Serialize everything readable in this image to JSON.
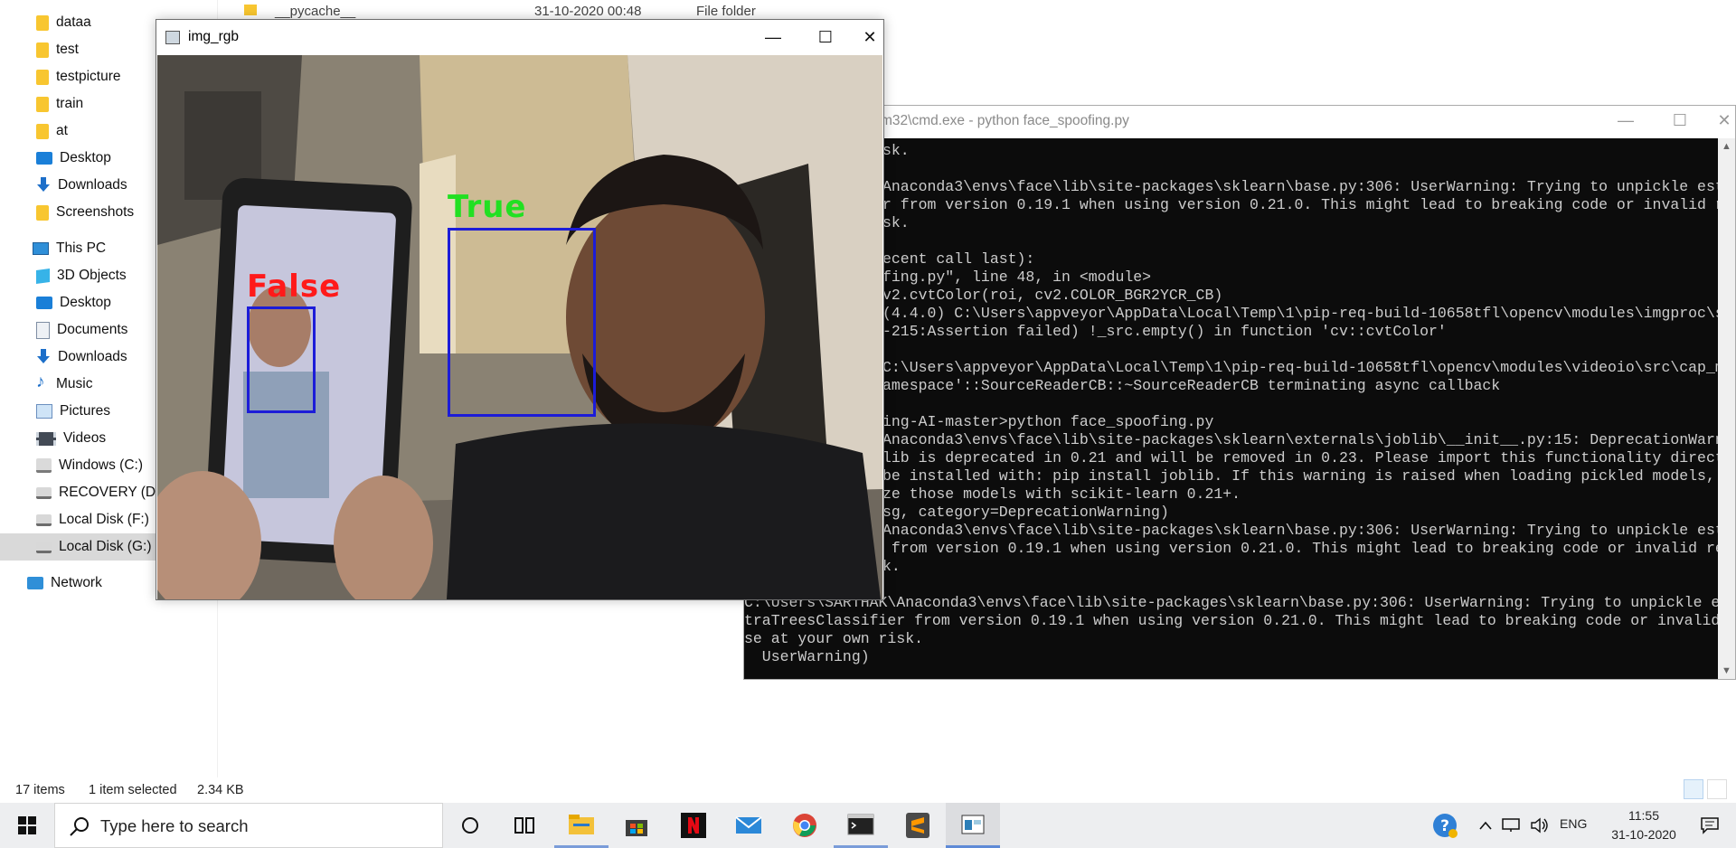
{
  "explorer": {
    "nav_items": [
      {
        "label": "dataa",
        "icon": "folder-icon"
      },
      {
        "label": "test",
        "icon": "folder-icon"
      },
      {
        "label": "testpicture",
        "icon": "folder-icon"
      },
      {
        "label": "train",
        "icon": "folder-icon"
      },
      {
        "label": "at",
        "icon": "folder-icon"
      },
      {
        "label": "Desktop",
        "icon": "desktop-icon"
      },
      {
        "label": "Downloads",
        "icon": "downloads-icon"
      },
      {
        "label": "Screenshots",
        "icon": "folder-icon"
      },
      {
        "label": "This PC",
        "icon": "this-pc-icon"
      },
      {
        "label": "3D Objects",
        "icon": "3d-objects-icon"
      },
      {
        "label": "Desktop",
        "icon": "desktop-icon"
      },
      {
        "label": "Documents",
        "icon": "documents-icon"
      },
      {
        "label": "Downloads",
        "icon": "downloads-icon"
      },
      {
        "label": "Music",
        "icon": "music-icon"
      },
      {
        "label": "Pictures",
        "icon": "pictures-icon"
      },
      {
        "label": "Videos",
        "icon": "videos-icon"
      },
      {
        "label": "Windows (C:)",
        "icon": "windows-drive-icon"
      },
      {
        "label": "RECOVERY (D:)",
        "icon": "disk-drive-icon"
      },
      {
        "label": "Local Disk (F:)",
        "icon": "disk-drive-icon"
      },
      {
        "label": "Local Disk (G:)",
        "icon": "disk-drive-icon"
      },
      {
        "label": "Network",
        "icon": "network-icon"
      }
    ],
    "file_row": {
      "name": "__pycache__",
      "date": "31-10-2020 00:48",
      "type": "File folder"
    },
    "status": {
      "count": "17 items",
      "selection": "1 item selected",
      "size": "2.34 KB"
    }
  },
  "console": {
    "title": "m32\\cmd.exe - python  face_spoofing.py",
    "lines": [
      "sk.",
      "",
      "Anaconda3\\envs\\face\\lib\\site-packages\\sklearn\\base.py:306: UserWarning: Trying to unpickle estimator Ex",
      "r from version 0.19.1 when using version 0.21.0. This might lead to breaking code or invalid results. U",
      "sk.",
      "",
      "ecent call last):",
      "fing.py\", line 48, in <module>",
      "v2.cvtColor(roi, cv2.COLOR_BGR2YCR_CB)",
      "(4.4.0) C:\\Users\\appveyor\\AppData\\Local\\Temp\\1\\pip-req-build-10658tfl\\opencv\\modules\\imgproc\\src\\color.",
      "-215:Assertion failed) !_src.empty() in function 'cv::cvtColor'",
      "",
      "C:\\Users\\appveyor\\AppData\\Local\\Temp\\1\\pip-req-build-10658tfl\\opencv\\modules\\videoio\\src\\cap_msmf.cpp (",
      "amespace'::SourceReaderCB::~SourceReaderCB terminating async callback",
      "",
      "ing-AI-master>python face_spoofing.py",
      "Anaconda3\\envs\\face\\lib\\site-packages\\sklearn\\externals\\joblib\\__init__.py:15: DeprecationWarning: skle",
      "lib is deprecated in 0.21 and will be removed in 0.23. Please import this functionality directly from j",
      "be installed with: pip install joblib. If this warning is raised when loading pickled models, you may n",
      "ze those models with scikit-learn 0.21+.",
      "sg, category=DeprecationWarning)",
      "Anaconda3\\envs\\face\\lib\\site-packages\\sklearn\\base.py:306: UserWarning: Trying to unpickle estimator Ex",
      " from version 0.19.1 when using version 0.21.0. This might lead to breaking code or invalid results. Us",
      "k.",
      "",
      "C:\\Users\\SARTHAK\\Anaconda3\\envs\\face\\lib\\site-packages\\sklearn\\base.py:306: UserWarning: Trying to unpickle estimator Ex",
      "traTreesClassifier from version 0.19.1 when using version 0.21.0. This might lead to breaking code or invalid results. U",
      "se at your own risk.",
      "  UserWarning)"
    ]
  },
  "image_window": {
    "title": "img_rgb",
    "detections": [
      {
        "label": "False",
        "color": "#ff1a1a"
      },
      {
        "label": "True",
        "color": "#22e022"
      }
    ]
  },
  "taskbar": {
    "search_placeholder": "Type here to search",
    "apps": [
      "cortana-icon",
      "task-view-icon",
      "file-explorer-icon",
      "store-icon",
      "netflix-icon",
      "mail-icon",
      "chrome-icon",
      "terminal-icon",
      "sublime-text-icon",
      "img-viewer-icon"
    ],
    "tray": {
      "language": "ENG",
      "time": "11:55",
      "date": "31-10-2020"
    }
  },
  "colors": {
    "accent": "#0078d7",
    "box": "#1c1cd8",
    "console_bg": "#0c0c0c",
    "console_text": "#cccccc"
  }
}
